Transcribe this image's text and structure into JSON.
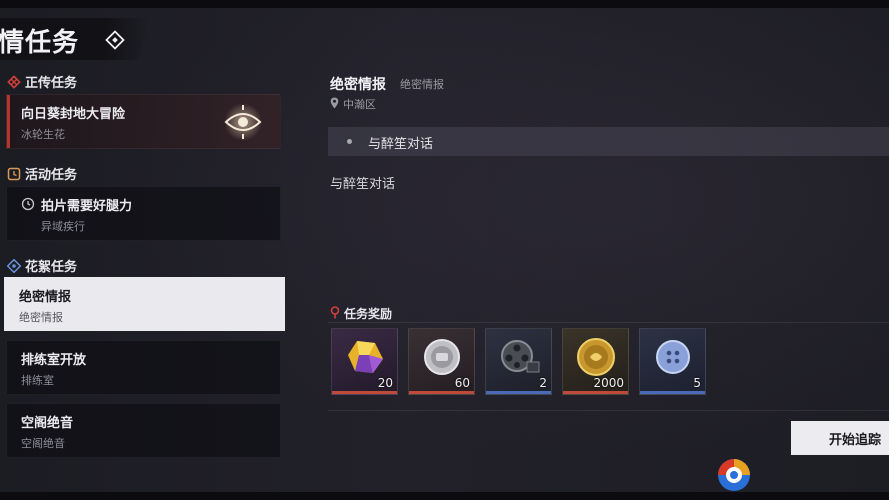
{
  "header": {
    "title": "情任务",
    "icon": "diamond-target-icon"
  },
  "categories": [
    {
      "label": "正传任务",
      "icon": "main-quest-icon",
      "color": "#d0413a"
    },
    {
      "label": "活动任务",
      "icon": "event-quest-icon",
      "color": "#d89a5a"
    },
    {
      "label": "花絮任务",
      "icon": "side-quest-icon",
      "color": "#6a8fd8"
    }
  ],
  "quests": [
    {
      "title": "向日葵封地大冒险",
      "subtitle": "冰轮生花"
    },
    {
      "title": "拍片需要好腿力",
      "subtitle": "异域疾行"
    },
    {
      "title": "绝密情报",
      "subtitle": "绝密情报"
    },
    {
      "title": "排练室开放",
      "subtitle": "排练室"
    },
    {
      "title": "空阁绝音",
      "subtitle": "空阁绝音"
    }
  ],
  "detail": {
    "title": "绝密情报",
    "subtitle": "绝密情报",
    "location": "中瀚区",
    "objective": "与醉笙对话",
    "description": "与醉笙对话"
  },
  "rewards": {
    "title": "任务奖励",
    "items": [
      {
        "name": "crystal",
        "count": "20"
      },
      {
        "name": "silver-coin",
        "count": "60"
      },
      {
        "name": "film-reel",
        "count": "2"
      },
      {
        "name": "gold-coin",
        "count": "2000"
      },
      {
        "name": "button-token",
        "count": "5"
      }
    ]
  },
  "track_button": "开始追踪"
}
